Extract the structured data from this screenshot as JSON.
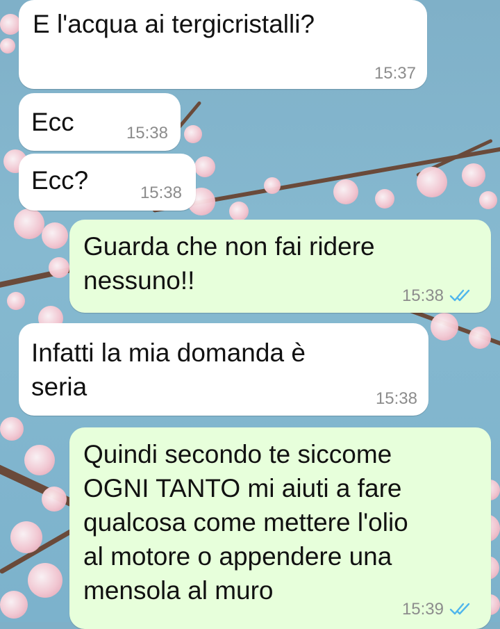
{
  "messages": [
    {
      "direction": "incoming",
      "text": "E l'acqua ai tergicristalli?",
      "time": "15:37"
    },
    {
      "direction": "incoming",
      "text": "Ecc",
      "time": "15:38"
    },
    {
      "direction": "incoming",
      "text": "Ecc?",
      "time": "15:38"
    },
    {
      "direction": "outgoing",
      "text": "Guarda che non fai ridere\nnessuno!!",
      "time": "15:38",
      "status_icon": "double-check-read-icon"
    },
    {
      "direction": "incoming",
      "text": "Infatti la mia domanda è\nseria",
      "time": "15:38"
    },
    {
      "direction": "outgoing",
      "text": "Quindi secondo te siccome\nOGNI TANTO mi aiuti a fare\nqualcosa come mettere l'olio\nal motore o appendere una\nmensola al muro",
      "time": "15:39",
      "status_icon": "double-check-read-icon"
    }
  ],
  "theme": {
    "incoming_bubble": "#ffffff",
    "outgoing_bubble": "#e7ffdb",
    "read_tick_color": "#4fb6ec",
    "wallpaper": "sky-blue with cherry blossom branches"
  }
}
